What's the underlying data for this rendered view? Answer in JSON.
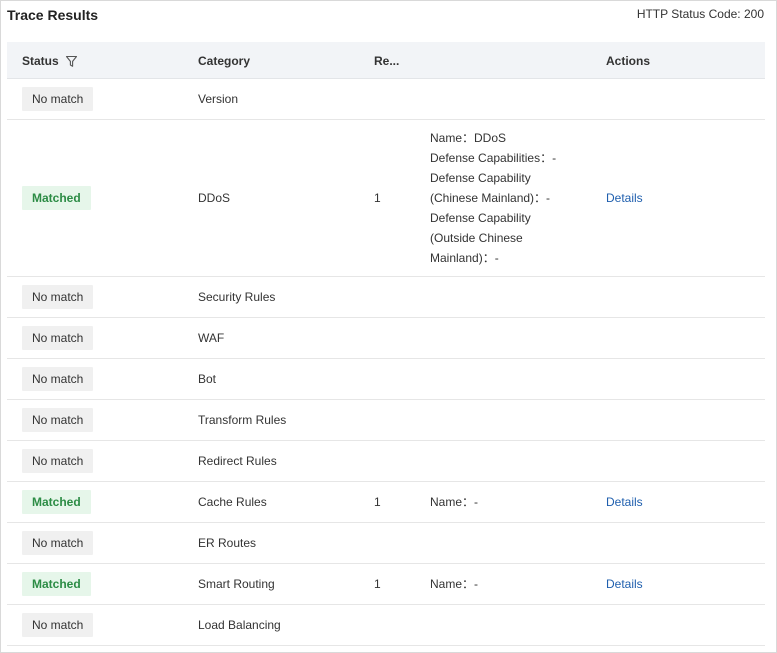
{
  "title": "Trace Results",
  "http_status": "HTTP Status Code: 200",
  "colors": {
    "matched_bg": "#e6f6ea",
    "matched_text": "#2c8c45",
    "link": "#1f5fae",
    "nomatch_bg": "#f0f0f0"
  },
  "table": {
    "columns": {
      "status": "Status",
      "category": "Category",
      "result": "Re...",
      "actions": "Actions"
    },
    "filter_icon": "filter-icon",
    "rows": [
      {
        "status": "No match",
        "category": "Version",
        "result": "",
        "details": [],
        "action": ""
      },
      {
        "status": "Matched",
        "category": "DDoS",
        "result": "1",
        "details": [
          "Name：DDoS",
          "Defense Capabilities：-",
          "Defense Capability",
          "(Chinese Mainland)：-",
          "Defense Capability",
          "(Outside Chinese",
          "Mainland)：-"
        ],
        "action": "Details"
      },
      {
        "status": "No match",
        "category": "Security Rules",
        "result": "",
        "details": [],
        "action": ""
      },
      {
        "status": "No match",
        "category": "WAF",
        "result": "",
        "details": [],
        "action": ""
      },
      {
        "status": "No match",
        "category": "Bot",
        "result": "",
        "details": [],
        "action": ""
      },
      {
        "status": "No match",
        "category": "Transform Rules",
        "result": "",
        "details": [],
        "action": ""
      },
      {
        "status": "No match",
        "category": "Redirect Rules",
        "result": "",
        "details": [],
        "action": ""
      },
      {
        "status": "Matched",
        "category": "Cache Rules",
        "result": "1",
        "details": [
          "Name：-"
        ],
        "action": "Details"
      },
      {
        "status": "No match",
        "category": "ER Routes",
        "result": "",
        "details": [],
        "action": ""
      },
      {
        "status": "Matched",
        "category": "Smart Routing",
        "result": "1",
        "details": [
          "Name：-"
        ],
        "action": "Details"
      },
      {
        "status": "No match",
        "category": "Load Balancing",
        "result": "",
        "details": [],
        "action": ""
      }
    ]
  }
}
